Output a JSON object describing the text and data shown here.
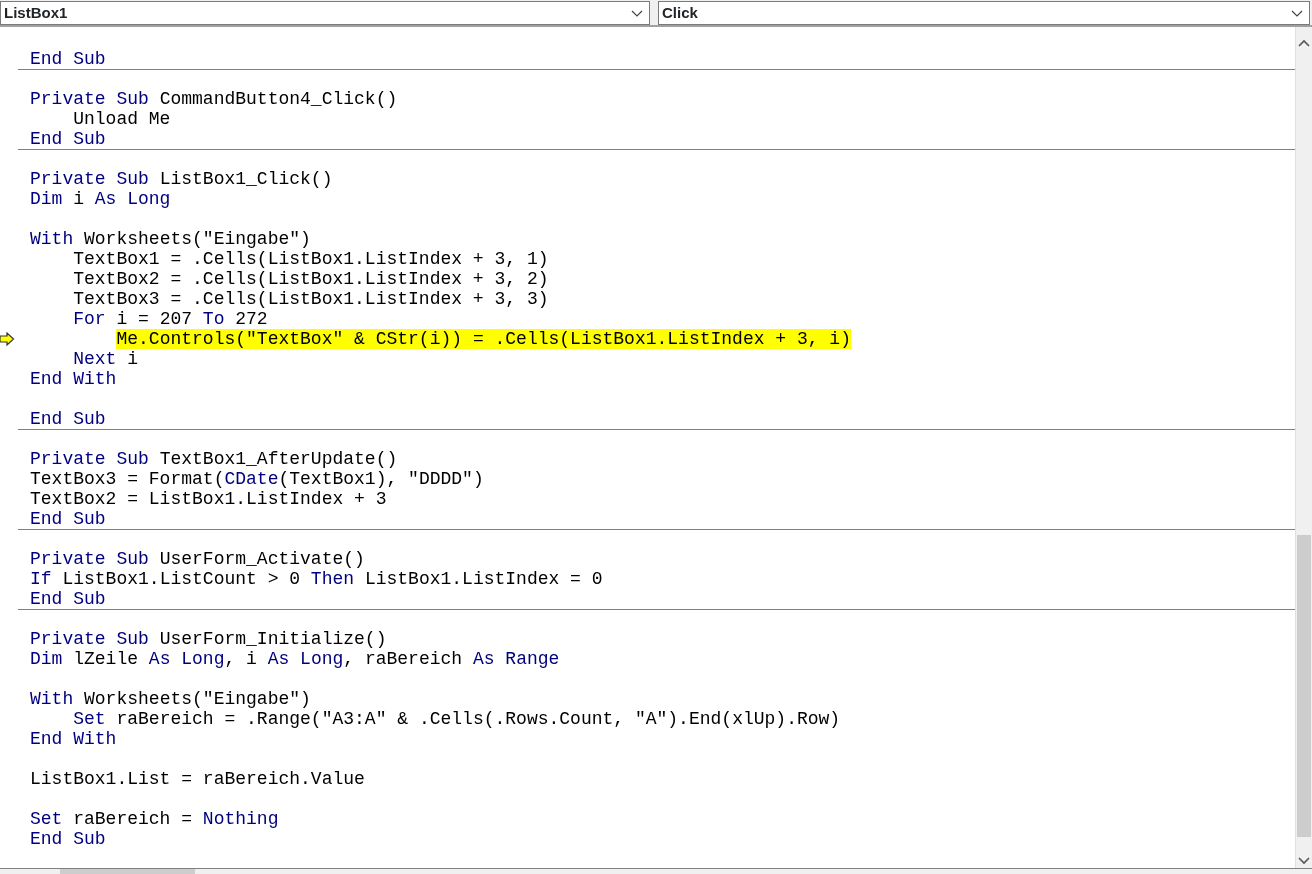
{
  "object_dropdown": {
    "value": "ListBox1"
  },
  "procedure_dropdown": {
    "value": "Click"
  },
  "procedures": [
    {
      "lines": [
        {
          "kind": "blank"
        },
        {
          "kind": "code",
          "tokens": [
            {
              "text": "End Sub",
              "keyword": true
            }
          ]
        }
      ]
    },
    {
      "lines": [
        {
          "kind": "blank"
        },
        {
          "kind": "code",
          "tokens": [
            {
              "text": "Private Sub",
              "keyword": true
            },
            {
              "text": " CommandButton4_Click()",
              "keyword": false
            }
          ]
        },
        {
          "kind": "code",
          "tokens": [
            {
              "text": "    Unload Me",
              "keyword": false
            }
          ]
        },
        {
          "kind": "code",
          "tokens": [
            {
              "text": "End Sub",
              "keyword": true
            }
          ]
        }
      ]
    },
    {
      "lines": [
        {
          "kind": "blank"
        },
        {
          "kind": "code",
          "tokens": [
            {
              "text": "Private Sub",
              "keyword": true
            },
            {
              "text": " ListBox1_Click()",
              "keyword": false
            }
          ]
        },
        {
          "kind": "code",
          "tokens": [
            {
              "text": "Dim",
              "keyword": true
            },
            {
              "text": " i ",
              "keyword": false
            },
            {
              "text": "As Long",
              "keyword": true
            }
          ]
        },
        {
          "kind": "blank"
        },
        {
          "kind": "code",
          "tokens": [
            {
              "text": "With",
              "keyword": true
            },
            {
              "text": " Worksheets(\"Eingabe\")",
              "keyword": false
            }
          ]
        },
        {
          "kind": "code",
          "tokens": [
            {
              "text": "    TextBox1 = .Cells(ListBox1.ListIndex + 3, 1)",
              "keyword": false
            }
          ]
        },
        {
          "kind": "code",
          "tokens": [
            {
              "text": "    TextBox2 = .Cells(ListBox1.ListIndex + 3, 2)",
              "keyword": false
            }
          ]
        },
        {
          "kind": "code",
          "tokens": [
            {
              "text": "    TextBox3 = .Cells(ListBox1.ListIndex + 3, 3)",
              "keyword": false
            }
          ]
        },
        {
          "kind": "code",
          "tokens": [
            {
              "text": "    For",
              "keyword": true
            },
            {
              "text": " i = 207 ",
              "keyword": false
            },
            {
              "text": "To",
              "keyword": true
            },
            {
              "text": " 272",
              "keyword": false
            }
          ]
        },
        {
          "kind": "code",
          "current": true,
          "tokens": [
            {
              "text": "        Me.Controls(\"TextBox\" & CStr(i)) = .Cells(ListBox1.ListIndex + 3, i)",
              "keyword": false
            }
          ]
        },
        {
          "kind": "code",
          "tokens": [
            {
              "text": "    Next",
              "keyword": true
            },
            {
              "text": " i",
              "keyword": false
            }
          ]
        },
        {
          "kind": "code",
          "tokens": [
            {
              "text": "End With",
              "keyword": true
            }
          ]
        },
        {
          "kind": "blank"
        },
        {
          "kind": "code",
          "tokens": [
            {
              "text": "End Sub",
              "keyword": true
            }
          ]
        }
      ]
    },
    {
      "lines": [
        {
          "kind": "blank"
        },
        {
          "kind": "code",
          "tokens": [
            {
              "text": "Private Sub",
              "keyword": true
            },
            {
              "text": " TextBox1_AfterUpdate()",
              "keyword": false
            }
          ]
        },
        {
          "kind": "code",
          "tokens": [
            {
              "text": "TextBox3 = Format(",
              "keyword": false
            },
            {
              "text": "CDate",
              "keyword": true
            },
            {
              "text": "(TextBox1), \"DDDD\")",
              "keyword": false
            }
          ]
        },
        {
          "kind": "code",
          "tokens": [
            {
              "text": "TextBox2 = ListBox1.ListIndex + 3",
              "keyword": false
            }
          ]
        },
        {
          "kind": "code",
          "tokens": [
            {
              "text": "End Sub",
              "keyword": true
            }
          ]
        }
      ]
    },
    {
      "lines": [
        {
          "kind": "blank"
        },
        {
          "kind": "code",
          "tokens": [
            {
              "text": "Private Sub",
              "keyword": true
            },
            {
              "text": " UserForm_Activate()",
              "keyword": false
            }
          ]
        },
        {
          "kind": "code",
          "tokens": [
            {
              "text": "If",
              "keyword": true
            },
            {
              "text": " ListBox1.ListCount > 0 ",
              "keyword": false
            },
            {
              "text": "Then",
              "keyword": true
            },
            {
              "text": " ListBox1.ListIndex = 0",
              "keyword": false
            }
          ]
        },
        {
          "kind": "code",
          "tokens": [
            {
              "text": "End Sub",
              "keyword": true
            }
          ]
        }
      ]
    },
    {
      "lines": [
        {
          "kind": "blank"
        },
        {
          "kind": "code",
          "tokens": [
            {
              "text": "Private Sub",
              "keyword": true
            },
            {
              "text": " UserForm_Initialize()",
              "keyword": false
            }
          ]
        },
        {
          "kind": "code",
          "tokens": [
            {
              "text": "Dim",
              "keyword": true
            },
            {
              "text": " lZeile ",
              "keyword": false
            },
            {
              "text": "As Long",
              "keyword": true
            },
            {
              "text": ", i ",
              "keyword": false
            },
            {
              "text": "As Long",
              "keyword": true
            },
            {
              "text": ", raBereich ",
              "keyword": false
            },
            {
              "text": "As Range",
              "keyword": true
            }
          ]
        },
        {
          "kind": "blank"
        },
        {
          "kind": "code",
          "tokens": [
            {
              "text": "With",
              "keyword": true
            },
            {
              "text": " Worksheets(\"Eingabe\")",
              "keyword": false
            }
          ]
        },
        {
          "kind": "code",
          "tokens": [
            {
              "text": "    Set",
              "keyword": true
            },
            {
              "text": " raBereich = .Range(\"A3:A\" & .Cells(.Rows.Count, \"A\").End(xlUp).Row)",
              "keyword": false
            }
          ]
        },
        {
          "kind": "code",
          "tokens": [
            {
              "text": "End With",
              "keyword": true
            }
          ]
        },
        {
          "kind": "blank"
        },
        {
          "kind": "code",
          "tokens": [
            {
              "text": "ListBox1.List = raBereich.Value",
              "keyword": false
            }
          ]
        },
        {
          "kind": "blank"
        },
        {
          "kind": "code",
          "tokens": [
            {
              "text": "Set",
              "keyword": true
            },
            {
              "text": " raBereich = ",
              "keyword": false
            },
            {
              "text": "Nothing",
              "keyword": true
            }
          ]
        },
        {
          "kind": "code",
          "tokens": [
            {
              "text": "End Sub",
              "keyword": true
            }
          ]
        }
      ]
    }
  ]
}
